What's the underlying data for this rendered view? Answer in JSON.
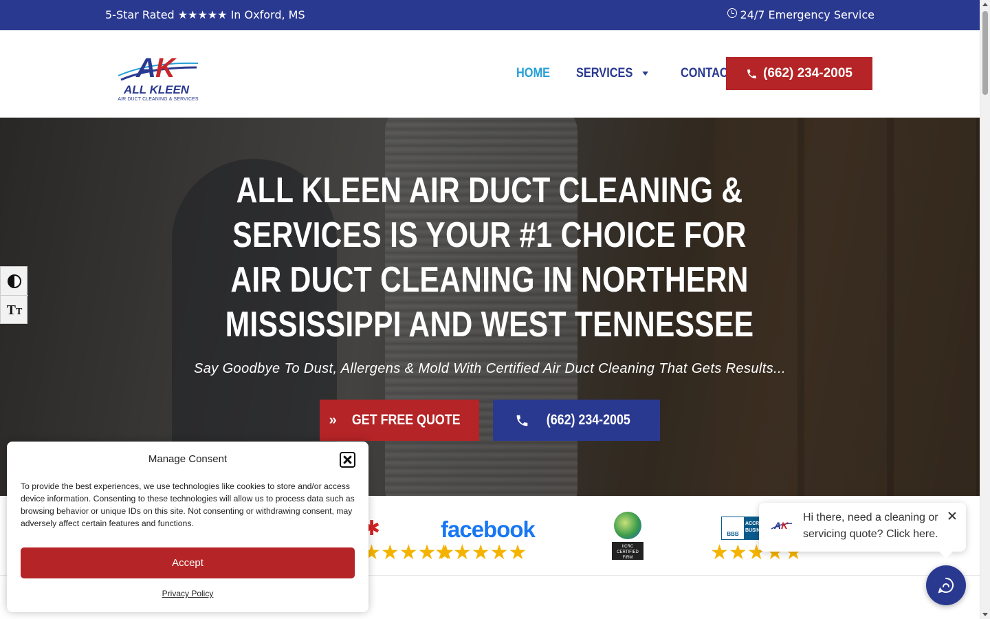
{
  "topbar": {
    "rating_text": "5-Star Rated ★★★★★ In Oxford, MS",
    "emergency_text": "24/7 Emergency Service"
  },
  "header": {
    "logo_text": "AK",
    "logo_name": "ALL KLEEN",
    "logo_sub": "AIR DUCT CLEANING & SERVICES",
    "nav": {
      "home": "HOME",
      "services": "SERVICES",
      "contact": "CONTACT US"
    },
    "phone": "(662) 234-2005"
  },
  "hero": {
    "title": "ALL KLEEN AIR DUCT CLEANING & SERVICES IS YOUR #1 CHOICE FOR AIR DUCT CLEANING IN NORTHERN MISSISSIPPI AND WEST TENNESSEE",
    "subtitle": "Say Goodbye To Dust, Allergens & Mold With Certified Air Duct Cleaning That Gets Results...",
    "quote_button": "GET FREE QUOTE",
    "call_button": "(662) 234-2005"
  },
  "reviews": {
    "facebook_label": "facebook",
    "iicrc_label": "IICRC CERTIFIED FIRM",
    "bbb_label": "BBB",
    "bbb_accredited": "ACCREDITED BUSINESS",
    "stars": "★★★★★"
  },
  "consent": {
    "title": "Manage Consent",
    "body": "To provide the best experiences, we use technologies like cookies to store and/or access device information. Consenting to these technologies will allow us to process data such as browsing behavior or unique IDs on this site. Not consenting or withdrawing consent, may adversely affect certain features and functions.",
    "accept": "Accept",
    "policy": "Privacy Policy"
  },
  "chat": {
    "message": "Hi there, need a cleaning or servicing quote? Click here."
  },
  "colors": {
    "brand_blue": "#2a3990",
    "brand_red": "#b52426",
    "nav_active": "#27a0d8",
    "star_gold": "#f5b301"
  }
}
